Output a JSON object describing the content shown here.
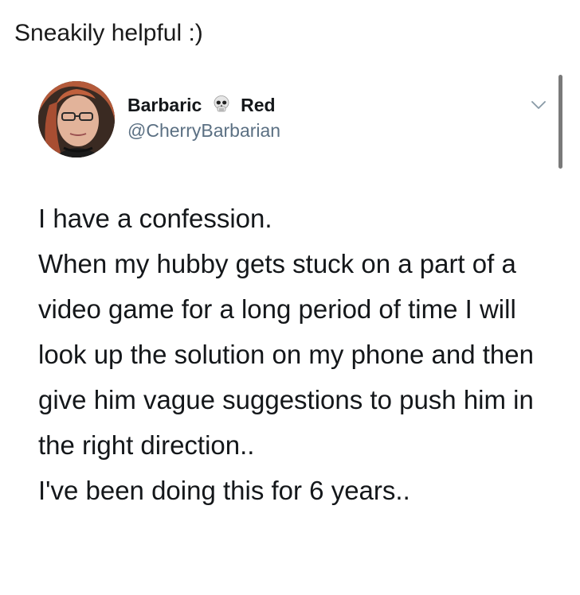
{
  "caption": "Sneakily helpful :)",
  "tweet": {
    "display_name_first": "Barbaric",
    "display_name_emoji": "skull-icon",
    "display_name_last": "Red",
    "handle": "@CherryBarbarian",
    "text_lines": [
      "I have a confession.",
      "When my hubby gets stuck on a part of a video game for a long period of time I will look up the solution on my phone and then give him vague suggestions to push him in the right direction..",
      "I've been doing this for 6 years.."
    ]
  },
  "colors": {
    "handle": "#5b7083",
    "text": "#14171a"
  }
}
